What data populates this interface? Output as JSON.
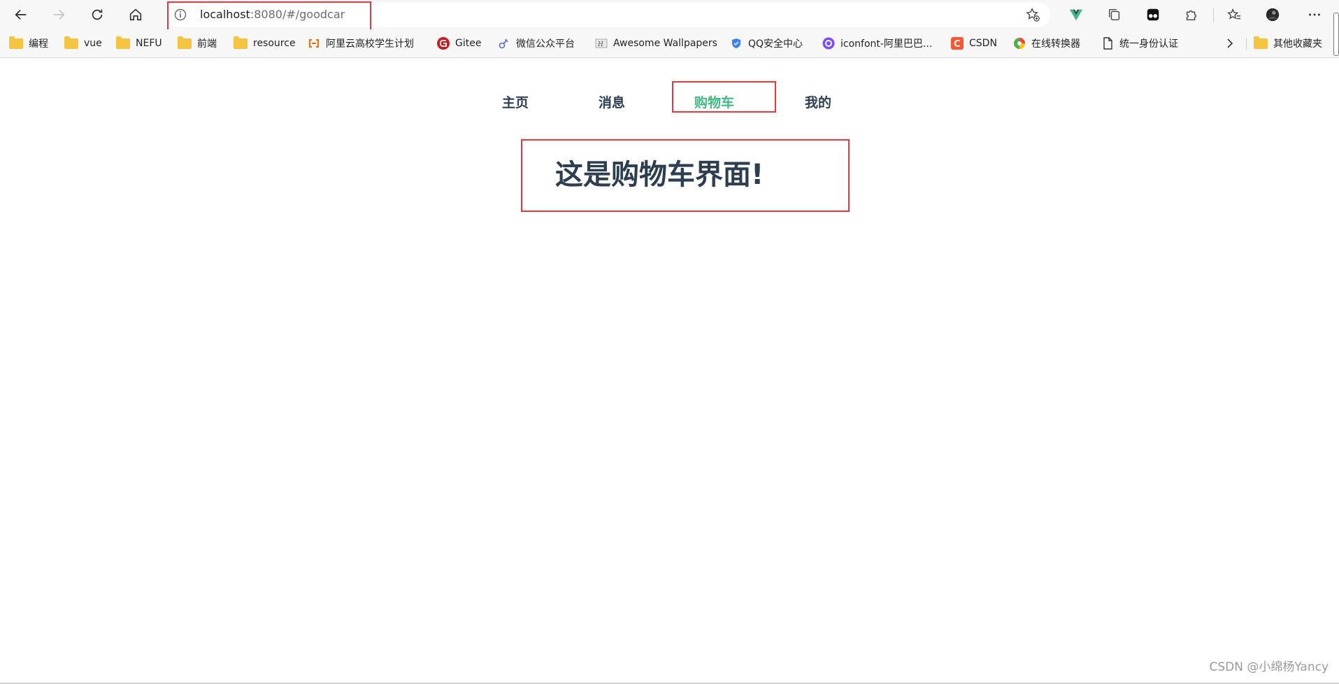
{
  "browser": {
    "url_host": "localhost",
    "url_rest": ":8080/#/goodcar"
  },
  "bookmarks": [
    {
      "label": "编程",
      "icon": "folder-icon"
    },
    {
      "label": "vue",
      "icon": "folder-icon"
    },
    {
      "label": "NEFU",
      "icon": "folder-icon"
    },
    {
      "label": "前端",
      "icon": "folder-icon"
    },
    {
      "label": "resource",
      "icon": "folder-icon"
    },
    {
      "label": "阿里云高校学生计划",
      "icon": "aliyun-icon"
    },
    {
      "label": "Gitee",
      "icon": "gitee-icon"
    },
    {
      "label": "微信公众平台",
      "icon": "wechat-mp-icon"
    },
    {
      "label": "Awesome Wallpapers",
      "icon": "wallpapers-icon"
    },
    {
      "label": "QQ安全中心",
      "icon": "shield-icon"
    },
    {
      "label": "iconfont-阿里巴巴...",
      "icon": "iconfont-icon"
    },
    {
      "label": "CSDN",
      "icon": "csdn-icon"
    },
    {
      "label": "在线转换器",
      "icon": "converter-icon"
    },
    {
      "label": "统一身份认证",
      "icon": "page-icon"
    },
    {
      "label": "其他收藏夹",
      "icon": "folder-icon"
    }
  ],
  "nav": {
    "items": [
      "主页",
      "消息",
      "购物车",
      "我的"
    ],
    "active": "购物车"
  },
  "page": {
    "heading": "这是购物车界面!"
  },
  "watermark": "CSDN @小绵杨Yancy",
  "colors": {
    "nav_text": "#2c3e50",
    "nav_active": "#42b983",
    "highlight_box": "#e8383d",
    "heading": "#2c3e50"
  }
}
